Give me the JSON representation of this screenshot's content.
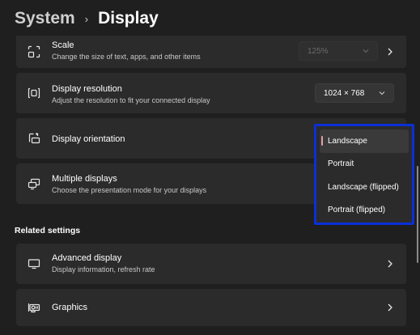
{
  "breadcrumb": {
    "parent": "System",
    "separator": "›",
    "current": "Display"
  },
  "scale": {
    "title": "Scale",
    "subtitle": "Change the size of text, apps, and other items",
    "value": "125%"
  },
  "resolution": {
    "title": "Display resolution",
    "subtitle": "Adjust the resolution to fit your connected display",
    "value": "1024 × 768"
  },
  "orientation": {
    "title": "Display orientation",
    "options": [
      "Landscape",
      "Portrait",
      "Landscape (flipped)",
      "Portrait (flipped)"
    ],
    "selected": "Landscape"
  },
  "multiple_displays": {
    "title": "Multiple displays",
    "subtitle": "Choose the presentation mode for your displays"
  },
  "related_settings": {
    "label": "Related settings",
    "advanced_display": {
      "title": "Advanced display",
      "subtitle": "Display information, refresh rate"
    },
    "graphics": {
      "title": "Graphics"
    }
  },
  "colors": {
    "background": "#1f1f1f",
    "card": "#2b2b2b",
    "highlight_border": "#0a2fd8",
    "selected_indicator": "#e4a0a0"
  }
}
